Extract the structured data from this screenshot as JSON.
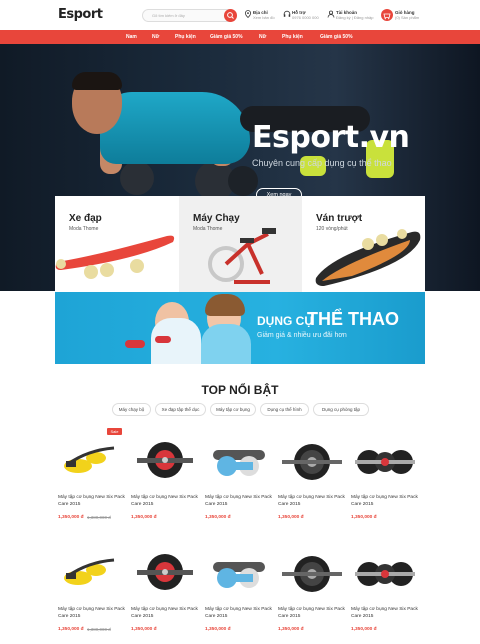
{
  "header": {
    "logo_text": "Esport",
    "search_placeholder": "Gõ tìm kiếm ở đây",
    "address_title": "Địa chỉ",
    "address_value": "Xem bản đồ",
    "support_title": "Hỗ trợ",
    "support_value": "0976 0000 000",
    "account_title": "Tài khoản",
    "account_value": "Đăng ký | Đăng nhập",
    "cart_title": "Giỏ hàng",
    "cart_value": "(0) Sản phẩm"
  },
  "nav": {
    "items": [
      "Nam",
      "Nữ",
      "Phụ kiện",
      "Giảm giá 50%",
      "Nữ",
      "Phụ kiện",
      "Giảm giá 50%"
    ]
  },
  "hero": {
    "title": "Esport.vn",
    "subtitle": "Chuyên cung cấp dụng cụ thể thao",
    "button": "Xem ngay"
  },
  "categories": [
    {
      "title": "Xe đạp",
      "sub": "Moda Thome"
    },
    {
      "title": "Máy Chạy",
      "sub": "Moda Thome"
    },
    {
      "title": "Ván trượt",
      "sub": "120 vòng/phút"
    }
  ],
  "promo": {
    "title_a": "DỤNG CỤ",
    "title_b": "THỂ THAO",
    "subtitle": "Giảm giá & nhiều ưu đãi hơn"
  },
  "top": {
    "title": "TOP NỔI BẬT",
    "tabs": [
      "Máy chạy bộ",
      "Xe đạp tập thể dục",
      "Máy tập cơ bụng",
      "Dụng cụ thể hình",
      "Dụng cụ phòng tập"
    ]
  },
  "products": [
    {
      "name": "Máy tập cơ bụng New Six Pack Care 2015",
      "price": "1,350,000 đ",
      "old": "1,380,000 đ",
      "sale": "Sale",
      "icon": "ab-roller-yellow-icon"
    },
    {
      "name": "Máy tập cơ bụng New Six Pack Care 2015",
      "price": "1,350,000 đ",
      "old": "",
      "sale": "",
      "icon": "ab-wheel-red-icon"
    },
    {
      "name": "Máy tập cơ bụng New Six Pack Care 2015",
      "price": "1,350,000 đ",
      "old": "",
      "sale": "",
      "icon": "ab-roller-blue-icon"
    },
    {
      "name": "Máy tập cơ bụng New Six Pack Care 2015",
      "price": "1,350,000 đ",
      "old": "",
      "sale": "",
      "icon": "ab-wheel-double-icon"
    },
    {
      "name": "Máy tập cơ bụng New Six Pack Care 2015",
      "price": "1,350,000 đ",
      "old": "",
      "sale": "",
      "icon": "ab-roller-triple-icon"
    },
    {
      "name": "Máy tập cơ bụng New Six Pack Care 2015",
      "price": "1,350,000 đ",
      "old": "1,380,000 đ",
      "sale": "",
      "icon": "ab-roller-yellow-icon"
    },
    {
      "name": "Máy tập cơ bụng New Six Pack Care 2015",
      "price": "1,350,000 đ",
      "old": "",
      "sale": "",
      "icon": "ab-wheel-red-icon"
    },
    {
      "name": "Máy tập cơ bụng New Six Pack Care 2015",
      "price": "1,350,000 đ",
      "old": "",
      "sale": "",
      "icon": "ab-roller-blue-icon"
    },
    {
      "name": "Máy tập cơ bụng New Six Pack Care 2015",
      "price": "1,350,000 đ",
      "old": "",
      "sale": "",
      "icon": "ab-wheel-double-icon"
    },
    {
      "name": "Máy tập cơ bụng New Six Pack Care 2015",
      "price": "1,350,000 đ",
      "old": "",
      "sale": "",
      "icon": "ab-roller-triple-icon"
    }
  ],
  "colors": {
    "accent": "#e8463b",
    "hero_bg": "#1a2a3b",
    "promo_bg": "#27b1e0"
  }
}
